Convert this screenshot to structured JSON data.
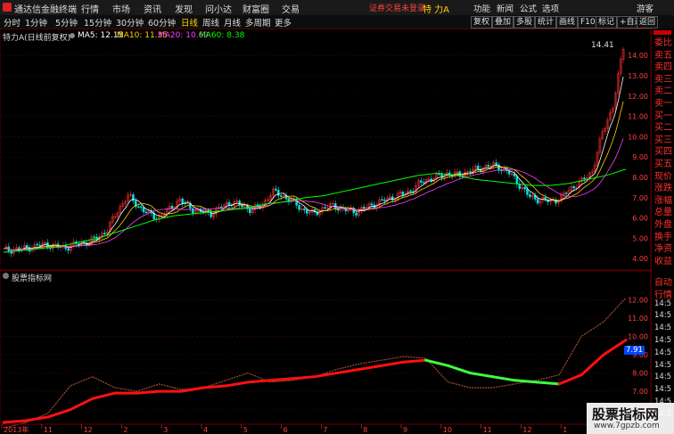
{
  "app": {
    "name": "通达信金融终端"
  },
  "menu": [
    "行情",
    "市场",
    "资讯",
    "发现",
    "问小达",
    "财富圈",
    "交易"
  ],
  "login_status": "证券交易未登录",
  "stock": {
    "name": "特 力A"
  },
  "right_menu": [
    "功能",
    "新闻",
    "公式",
    "选项",
    "游客"
  ],
  "toolbar": {
    "periods": [
      "分时",
      "1分钟",
      "5分钟",
      "15分钟",
      "30分钟",
      "60分钟",
      "日线",
      "周线",
      "月线",
      "多周期",
      "更多"
    ],
    "active": "日线",
    "buttons": [
      "复权",
      "叠加",
      "多股",
      "统计",
      "画线",
      "F10",
      "标记",
      "+自选",
      "返回"
    ]
  },
  "main_chart_header": {
    "title": "特力A(日线前复权)",
    "ma5": "MA5: 12.15",
    "ma10": "MA10: 11.35",
    "ma20": "MA20: 10.69",
    "ma60": "MA60: 8.38",
    "peak": "14.41"
  },
  "sub_chart_header": {
    "title": "股票指标网",
    "value_tag": "7.91"
  },
  "colors": {
    "ma5": "#ffffff",
    "ma10": "#ffd000",
    "ma20": "#ff40ff",
    "ma60": "#00ff00",
    "up": "#ff3030",
    "down": "#00e0e0",
    "sub_red": "#ff1010",
    "sub_green": "#40ff40"
  },
  "chart_data": [
    {
      "type": "candlestick",
      "title": "特力A(日线前复权)",
      "y_ticks": [
        "14.00",
        "13.00",
        "12.00",
        "11.00",
        "10.00",
        "9.00",
        "8.00",
        "7.00",
        "6.00",
        "5.00",
        "4.00"
      ],
      "ylim": [
        3.7,
        14.8
      ],
      "x_ticks": [
        "2013年",
        "11",
        "12",
        "2",
        "3",
        "4",
        "5",
        "6",
        "7",
        "8",
        "9",
        "10",
        "11",
        "12",
        "1",
        "2"
      ],
      "close_approx": [
        4.4,
        4.45,
        4.5,
        4.6,
        4.7,
        4.6,
        4.55,
        4.7,
        4.8,
        5.0,
        5.4,
        6.3,
        7.1,
        6.6,
        6.2,
        6.0,
        6.4,
        6.9,
        6.5,
        6.3,
        6.2,
        6.5,
        6.8,
        6.6,
        6.4,
        6.6,
        7.3,
        7.1,
        6.8,
        6.4,
        6.2,
        6.5,
        6.6,
        6.4,
        6.3,
        6.5,
        6.7,
        6.9,
        7.1,
        7.2,
        7.6,
        7.9,
        8.0,
        8.2,
        8.1,
        8.3,
        8.4,
        8.6,
        8.5,
        8.2,
        7.6,
        7.0,
        6.9,
        6.8,
        7.0,
        7.5,
        7.8,
        8.3,
        10.2,
        11.5,
        14.4
      ],
      "ma60_approx": [
        4.3,
        4.4,
        4.5,
        4.6,
        4.8,
        5.0,
        5.3,
        5.6,
        5.9,
        6.1,
        6.2,
        6.3,
        6.4,
        6.5,
        6.7,
        6.8,
        7.0,
        7.1,
        7.3,
        7.5,
        7.7,
        7.9,
        8.1,
        8.2,
        8.1,
        7.9,
        7.8,
        7.7,
        7.6,
        7.6,
        7.7,
        7.9,
        8.1,
        8.4
      ]
    },
    {
      "type": "line",
      "title": "股票指标网",
      "y_ticks": [
        "12.00",
        "11.00",
        "10.00",
        "9.00",
        "8.00",
        "7.00",
        "6.00"
      ],
      "ylim": [
        5.4,
        12.7
      ],
      "series": [
        {
          "values": [
            5.3,
            5.4,
            5.6,
            6.0,
            6.6,
            6.9,
            6.9,
            7.0,
            7.0,
            7.2,
            7.3,
            7.5,
            7.6,
            7.7,
            7.8,
            8.0,
            8.2,
            8.4,
            8.6,
            8.7,
            8.4,
            8.0,
            7.8,
            7.6,
            7.5,
            7.4,
            7.9,
            9.0,
            9.8
          ]
        },
        {
          "values": [
            5.0,
            5.3,
            5.8,
            7.3,
            7.8,
            7.2,
            7.0,
            7.4,
            7.1,
            7.2,
            7.6,
            8.0,
            7.5,
            7.6,
            7.8,
            8.2,
            8.5,
            8.7,
            8.9,
            8.8,
            7.5,
            7.2,
            7.2,
            7.4,
            7.6,
            7.9,
            10.0,
            10.8,
            12.1
          ]
        }
      ]
    }
  ],
  "right_panel": {
    "top_labels": [
      "委比",
      "卖五",
      "卖四",
      "卖三",
      "卖二",
      "卖一",
      "买一",
      "买二",
      "买三",
      "买四",
      "买五",
      "现价",
      "涨跌",
      "涨幅",
      "总量",
      "外盘",
      "换手",
      "净资",
      "收益"
    ],
    "bottom_labels": [
      "自动",
      "行情",
      "14:5",
      "14:5",
      "14:5",
      "14:5",
      "14:5",
      "14:5",
      "14:5",
      "14:5",
      "14:5",
      "14:5"
    ]
  },
  "watermark": {
    "text": "股票指标网",
    "url": "www.7gpzb.com"
  }
}
